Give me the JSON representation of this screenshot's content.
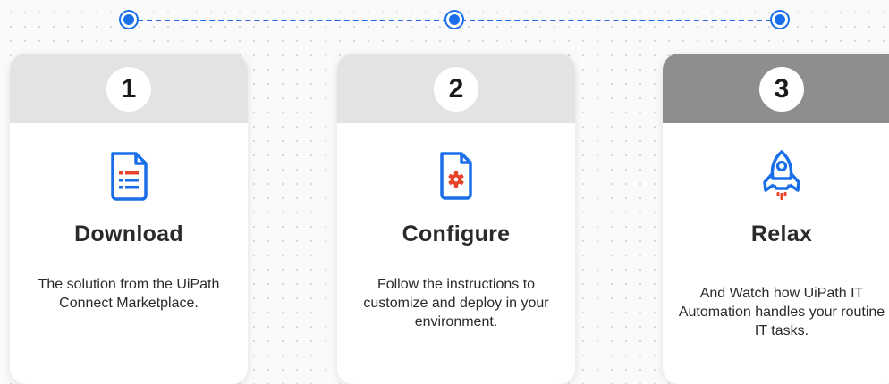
{
  "colors": {
    "accent_blue": "#1a6fe8",
    "accent_red": "#e8442a",
    "header_light": "#e3e3e3",
    "header_dark": "#8e8e8e",
    "text": "#2a2a2a"
  },
  "steps": [
    {
      "number": "1",
      "title": "Download",
      "description": "The solution from the UiPath Connect Marketplace.",
      "icon": "document-list-icon"
    },
    {
      "number": "2",
      "title": "Configure",
      "description": "Follow the instructions to customize and deploy in your environment.",
      "icon": "document-gear-icon"
    },
    {
      "number": "3",
      "title": "Relax",
      "description": "And Watch how UiPath IT Automation handles your routine IT tasks.",
      "icon": "rocket-icon"
    }
  ]
}
